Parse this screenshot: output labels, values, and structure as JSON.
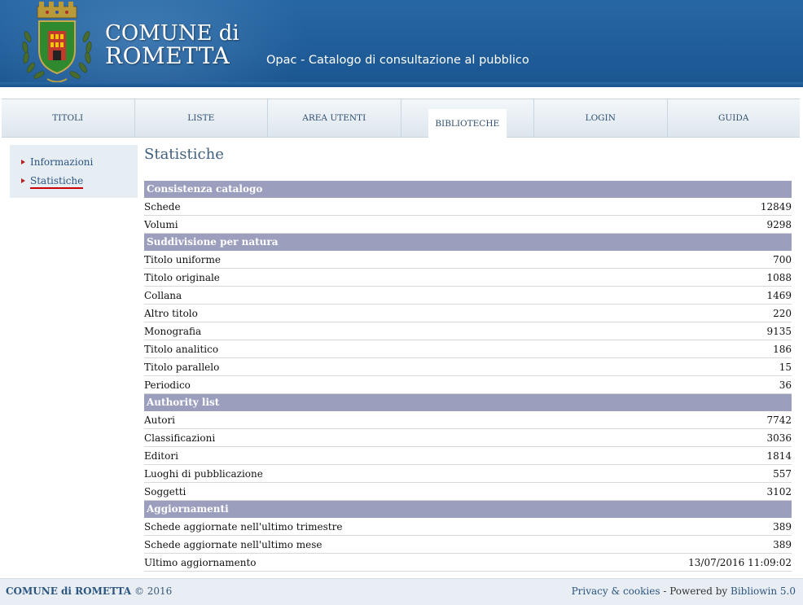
{
  "header": {
    "title_line1": "COMUNE di",
    "title_line2": "ROMETTA",
    "subtitle": "Opac - Catalogo di consultazione al pubblico"
  },
  "nav": {
    "items": [
      "TITOLI",
      "LISTE",
      "AREA UTENTI",
      "BIBLIOTECHE",
      "LOGIN",
      "GUIDA"
    ],
    "active": "BIBLIOTECHE"
  },
  "sidebar": {
    "items": [
      "Informazioni",
      "Statistiche"
    ],
    "active": "Statistiche"
  },
  "main": {
    "title": "Statistiche",
    "sections": [
      {
        "title": "Consistenza catalogo",
        "rows": [
          {
            "label": "Schede",
            "value": "12849"
          },
          {
            "label": "Volumi",
            "value": "9298"
          }
        ]
      },
      {
        "title": "Suddivisione per natura",
        "rows": [
          {
            "label": "Titolo uniforme",
            "value": "700"
          },
          {
            "label": "Titolo originale",
            "value": "1088"
          },
          {
            "label": "Collana",
            "value": "1469"
          },
          {
            "label": "Altro titolo",
            "value": "220"
          },
          {
            "label": "Monografia",
            "value": "9135"
          },
          {
            "label": "Titolo analitico",
            "value": "186"
          },
          {
            "label": "Titolo parallelo",
            "value": "15"
          },
          {
            "label": "Periodico",
            "value": "36"
          }
        ]
      },
      {
        "title": "Authority list",
        "rows": [
          {
            "label": "Autori",
            "value": "7742"
          },
          {
            "label": "Classificazioni",
            "value": "3036"
          },
          {
            "label": "Editori",
            "value": "1814"
          },
          {
            "label": "Luoghi di pubblicazione",
            "value": "557"
          },
          {
            "label": "Soggetti",
            "value": "3102"
          }
        ]
      },
      {
        "title": "Aggiornamenti",
        "rows": [
          {
            "label": "Schede aggiornate nell'ultimo trimestre",
            "value": "389"
          },
          {
            "label": "Schede aggiornate nell'ultimo mese",
            "value": "389"
          },
          {
            "label": "Ultimo aggiornamento",
            "value": "13/07/2016 11:09:02"
          }
        ]
      }
    ]
  },
  "footer": {
    "site_name": "COMUNE di ROMETTA",
    "copyright": "© 2016",
    "privacy_link": "Privacy & cookies",
    "powered_by": "- Powered by",
    "product_link": "Bibliowin 5.0"
  },
  "colors": {
    "header_blue": "#1f5c98",
    "section_header": "#9b9fbd",
    "link": "#2c5580",
    "active_underline": "#cc0000"
  },
  "icons": {
    "crest": "coat-of-arms-icon",
    "bullet": "red-triangle-bullet-icon"
  }
}
